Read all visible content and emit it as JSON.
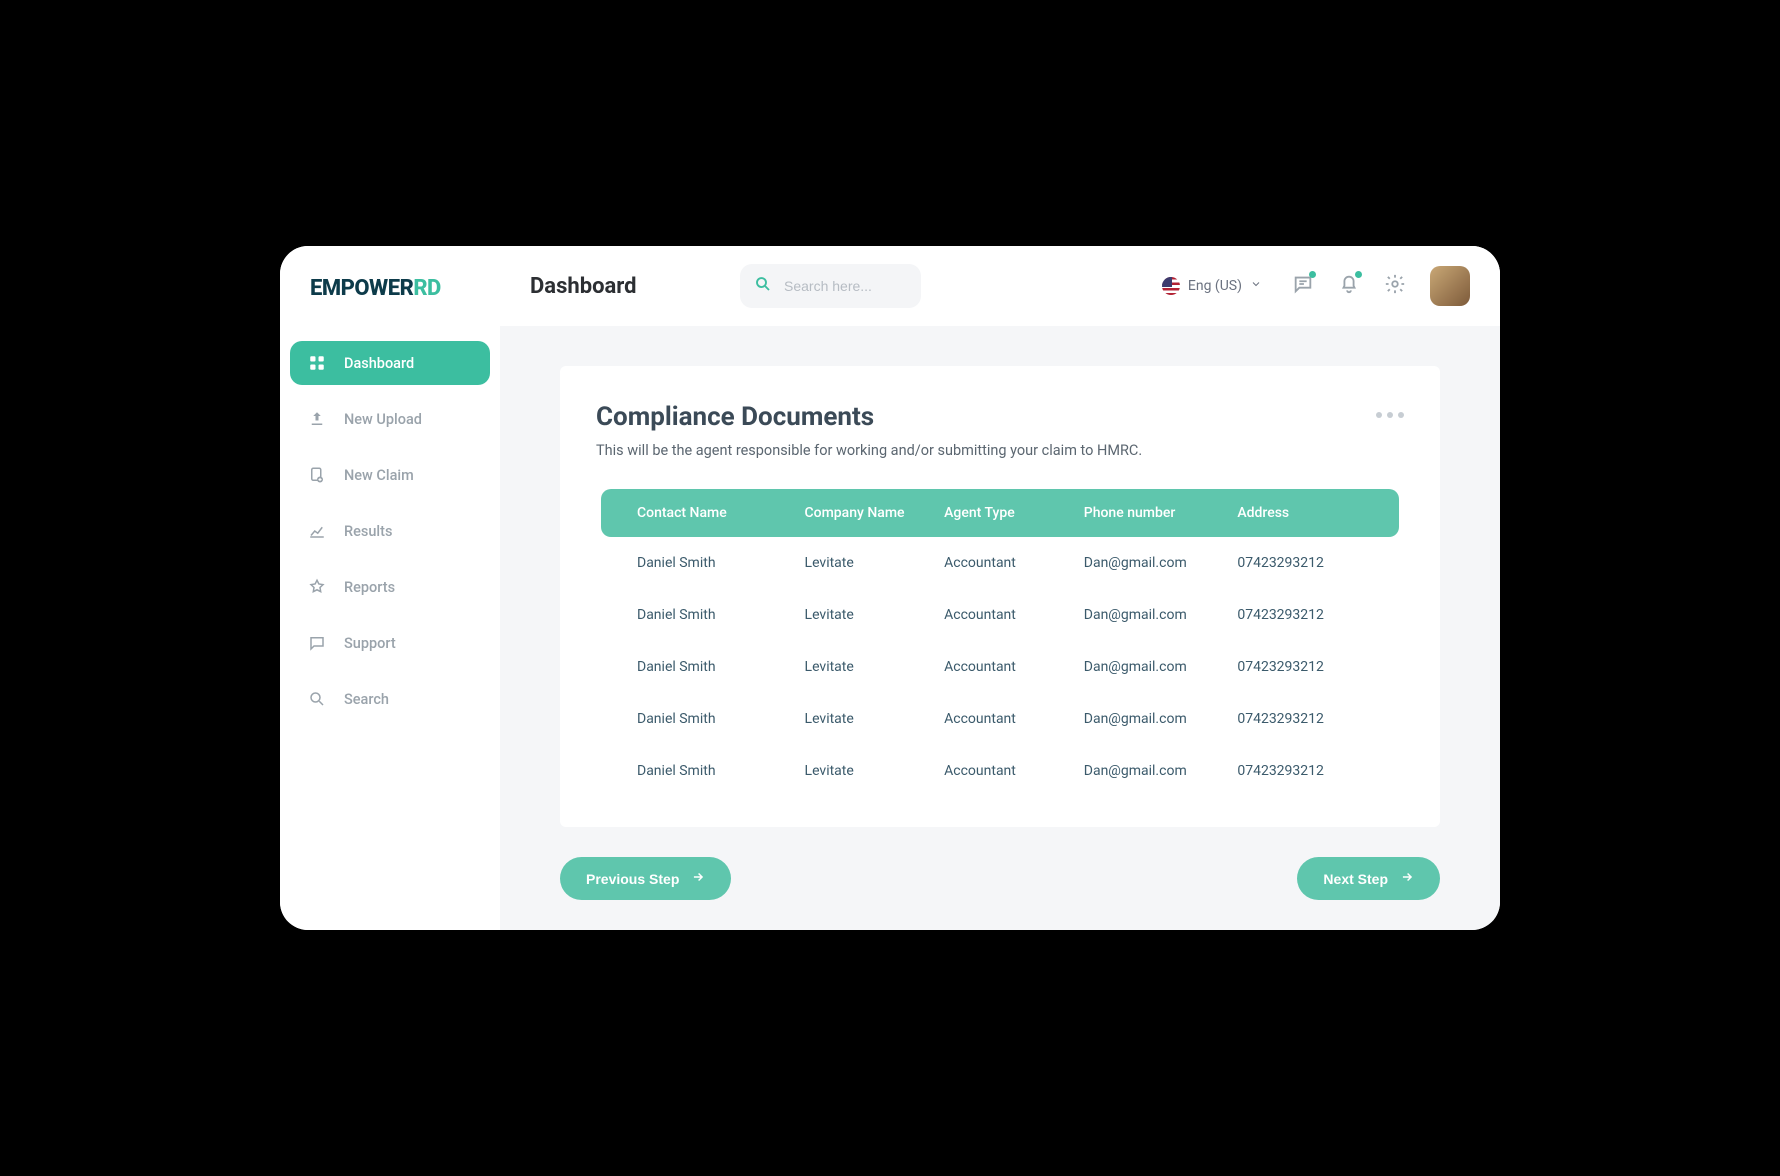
{
  "logo": {
    "empower": "EMPOWER",
    "rd": "RD"
  },
  "sidebar": {
    "items": [
      {
        "label": "Dashboard",
        "active": true
      },
      {
        "label": "New Upload",
        "active": false
      },
      {
        "label": "New Claim",
        "active": false
      },
      {
        "label": "Results",
        "active": false
      },
      {
        "label": "Reports",
        "active": false
      },
      {
        "label": "Support",
        "active": false
      },
      {
        "label": "Search",
        "active": false
      }
    ]
  },
  "header": {
    "title": "Dashboard",
    "search_placeholder": "Search here...",
    "language": "Eng (US)"
  },
  "card": {
    "title": "Compliance Documents",
    "subtitle": "This will be the agent responsible for working and/or submitting your claim to HMRC.",
    "columns": [
      "Contact Name",
      "Company Name",
      "Agent Type",
      "Phone number",
      "Address"
    ],
    "rows": [
      {
        "contact": "Daniel Smith",
        "company": "Levitate",
        "type": "Accountant",
        "phone": "Dan@gmail.com",
        "address": "07423293212"
      },
      {
        "contact": "Daniel Smith",
        "company": "Levitate",
        "type": "Accountant",
        "phone": "Dan@gmail.com",
        "address": "07423293212"
      },
      {
        "contact": "Daniel Smith",
        "company": "Levitate",
        "type": "Accountant",
        "phone": "Dan@gmail.com",
        "address": "07423293212"
      },
      {
        "contact": "Daniel Smith",
        "company": "Levitate",
        "type": "Accountant",
        "phone": "Dan@gmail.com",
        "address": "07423293212"
      },
      {
        "contact": "Daniel Smith",
        "company": "Levitate",
        "type": "Accountant",
        "phone": "Dan@gmail.com",
        "address": "07423293212"
      }
    ]
  },
  "buttons": {
    "prev": "Previous Step",
    "next": "Next Step"
  }
}
